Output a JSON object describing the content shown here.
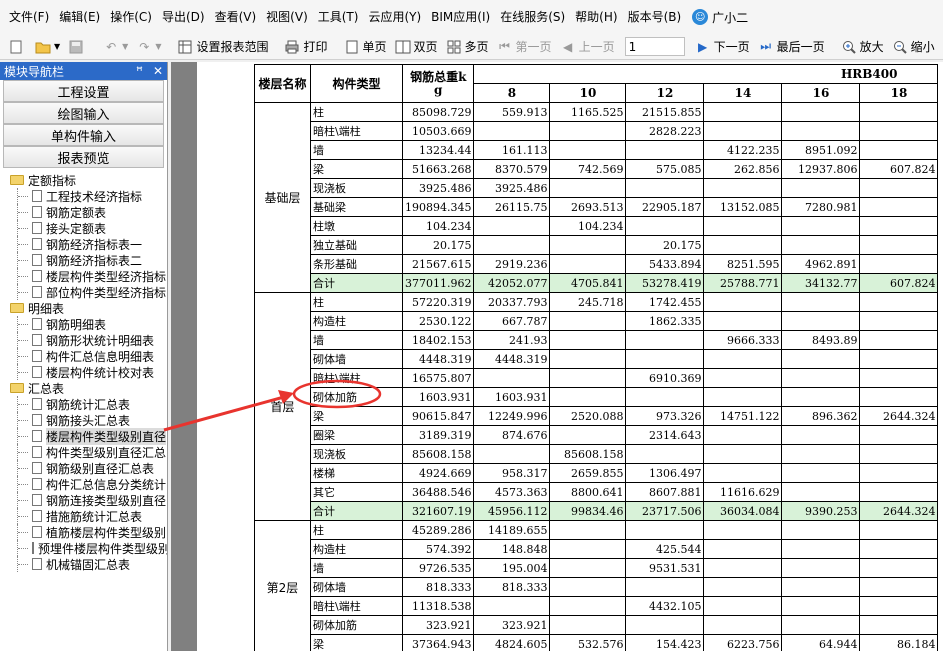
{
  "menubar": {
    "items": [
      "文件(F)",
      "编辑(E)",
      "操作(C)",
      "导出(D)",
      "查看(V)",
      "视图(V)",
      "工具(T)",
      "云应用(Y)",
      "BIM应用(I)",
      "在线服务(S)",
      "帮助(H)",
      "版本号(B)"
    ],
    "assistant": "广小二"
  },
  "toolbar": {
    "set_range": "设置报表范围",
    "print": "打印",
    "single_page": "单页",
    "double_page": "双页",
    "multi_page": "多页",
    "first_page": "第一页",
    "prev_page": "上一页",
    "page_value": "1",
    "next_page": "下一页",
    "last_page": "最后一页",
    "zoom_in": "放大",
    "zoom_out": "缩小"
  },
  "nav": {
    "title": "模块导航栏",
    "pin": "ꟸ",
    "close": "✕",
    "buttons": [
      "工程设置",
      "绘图输入",
      "单构件输入",
      "报表预览"
    ],
    "folders": [
      {
        "label": "定额指标",
        "items": [
          "工程技术经济指标",
          "钢筋定额表",
          "接头定额表",
          "钢筋经济指标表一",
          "钢筋经济指标表二",
          "楼层构件类型经济指标",
          "部位构件类型经济指标"
        ]
      },
      {
        "label": "明细表",
        "items": [
          "钢筋明细表",
          "钢筋形状统计明细表",
          "构件汇总信息明细表",
          "楼层构件统计校对表"
        ]
      },
      {
        "label": "汇总表",
        "items": [
          "钢筋统计汇总表",
          "钢筋接头汇总表",
          "楼层构件类型级别直径",
          "构件类型级别直径汇总",
          "钢筋级别直径汇总表",
          "构件汇总信息分类统计",
          "钢筋连接类型级别直径",
          "措施筋统计汇总表",
          "植筋楼层构件类型级别",
          "预埋件楼层构件类型级别",
          "机械锚固汇总表"
        ]
      }
    ],
    "selected_item": "楼层构件类型级别直径"
  },
  "report": {
    "headers": {
      "floor": "楼层名称",
      "type": "构件类型",
      "total_weight_line1": "钢筋总重k",
      "total_weight_line2": "g",
      "grade": "HRB400",
      "diameters": [
        "8",
        "10",
        "12",
        "14",
        "16",
        "18"
      ]
    },
    "groups": [
      {
        "floor": "基础层",
        "rows": [
          {
            "type": "柱",
            "total": "85098.729",
            "vals": [
              "559.913",
              "1165.525",
              "21515.855",
              "",
              "",
              ""
            ]
          },
          {
            "type": "暗柱\\端柱",
            "total": "10503.669",
            "vals": [
              "",
              "",
              "2828.223",
              "",
              "",
              ""
            ]
          },
          {
            "type": "墙",
            "total": "13234.44",
            "vals": [
              "161.113",
              "",
              "",
              "4122.235",
              "8951.092",
              ""
            ]
          },
          {
            "type": "梁",
            "total": "51663.268",
            "vals": [
              "8370.579",
              "742.569",
              "575.085",
              "262.856",
              "12937.806",
              "607.824"
            ]
          },
          {
            "type": "现浇板",
            "total": "3925.486",
            "vals": [
              "3925.486",
              "",
              "",
              "",
              "",
              ""
            ]
          },
          {
            "type": "基础梁",
            "total": "190894.345",
            "vals": [
              "26115.75",
              "2693.513",
              "22905.187",
              "13152.085",
              "7280.981",
              ""
            ]
          },
          {
            "type": "柱墩",
            "total": "104.234",
            "vals": [
              "",
              "104.234",
              "",
              "",
              "",
              ""
            ]
          },
          {
            "type": "独立基础",
            "total": "20.175",
            "vals": [
              "",
              "",
              "20.175",
              "",
              "",
              ""
            ]
          },
          {
            "type": "条形基础",
            "total": "21567.615",
            "vals": [
              "2919.236",
              "",
              "5433.894",
              "8251.595",
              "4962.891",
              ""
            ]
          },
          {
            "type": "合计",
            "total": "377011.962",
            "vals": [
              "42052.077",
              "4705.841",
              "53278.419",
              "25788.771",
              "34132.77",
              "607.824"
            ],
            "is_total": true
          }
        ]
      },
      {
        "floor": "首层",
        "rows": [
          {
            "type": "柱",
            "total": "57220.319",
            "vals": [
              "20337.793",
              "245.718",
              "1742.455",
              "",
              "",
              ""
            ]
          },
          {
            "type": "构造柱",
            "total": "2530.122",
            "vals": [
              "667.787",
              "",
              "1862.335",
              "",
              "",
              ""
            ]
          },
          {
            "type": "墙",
            "total": "18402.153",
            "vals": [
              "241.93",
              "",
              "",
              "9666.333",
              "8493.89",
              ""
            ]
          },
          {
            "type": "砌体墙",
            "total": "4448.319",
            "vals": [
              "4448.319",
              "",
              "",
              "",
              "",
              ""
            ]
          },
          {
            "type": "暗柱\\端柱",
            "total": "16575.807",
            "vals": [
              "",
              "",
              "6910.369",
              "",
              "",
              ""
            ]
          },
          {
            "type": "砌体加筋",
            "total": "1603.931",
            "vals": [
              "1603.931",
              "",
              "",
              "",
              "",
              ""
            ]
          },
          {
            "type": "梁",
            "total": "90615.847",
            "vals": [
              "12249.996",
              "2520.088",
              "973.326",
              "14751.122",
              "896.362",
              "2644.324"
            ]
          },
          {
            "type": "圈梁",
            "total": "3189.319",
            "vals": [
              "874.676",
              "",
              "2314.643",
              "",
              "",
              ""
            ]
          },
          {
            "type": "现浇板",
            "total": "85608.158",
            "vals": [
              "",
              "85608.158",
              "",
              "",
              "",
              ""
            ]
          },
          {
            "type": "楼梯",
            "total": "4924.669",
            "vals": [
              "958.317",
              "2659.855",
              "1306.497",
              "",
              "",
              ""
            ]
          },
          {
            "type": "其它",
            "total": "36488.546",
            "vals": [
              "4573.363",
              "8800.641",
              "8607.881",
              "11616.629",
              "",
              ""
            ]
          },
          {
            "type": "合计",
            "total": "321607.19",
            "vals": [
              "45956.112",
              "99834.46",
              "23717.506",
              "36034.084",
              "9390.253",
              "2644.324"
            ],
            "is_total": true
          }
        ]
      },
      {
        "floor": "第2层",
        "rows": [
          {
            "type": "柱",
            "total": "45289.286",
            "vals": [
              "14189.655",
              "",
              "",
              "",
              "",
              ""
            ]
          },
          {
            "type": "构造柱",
            "total": "574.392",
            "vals": [
              "148.848",
              "",
              "425.544",
              "",
              "",
              ""
            ]
          },
          {
            "type": "墙",
            "total": "9726.535",
            "vals": [
              "195.004",
              "",
              "9531.531",
              "",
              "",
              ""
            ]
          },
          {
            "type": "砌体墙",
            "total": "818.333",
            "vals": [
              "818.333",
              "",
              "",
              "",
              "",
              ""
            ]
          },
          {
            "type": "暗柱\\端柱",
            "total": "11318.538",
            "vals": [
              "",
              "",
              "4432.105",
              "",
              "",
              ""
            ]
          },
          {
            "type": "砌体加筋",
            "total": "323.921",
            "vals": [
              "323.921",
              "",
              "",
              "",
              "",
              ""
            ]
          },
          {
            "type": "梁",
            "total": "37364.943",
            "vals": [
              "4824.605",
              "532.576",
              "154.423",
              "6223.756",
              "64.944",
              "86.184"
            ]
          }
        ]
      }
    ]
  },
  "colors": {
    "nav_title_bg": "#2c6ac8",
    "total_row_bg": "#d8f2d8",
    "annotation_red": "#e8342e",
    "viewer_bg": "#808080"
  }
}
